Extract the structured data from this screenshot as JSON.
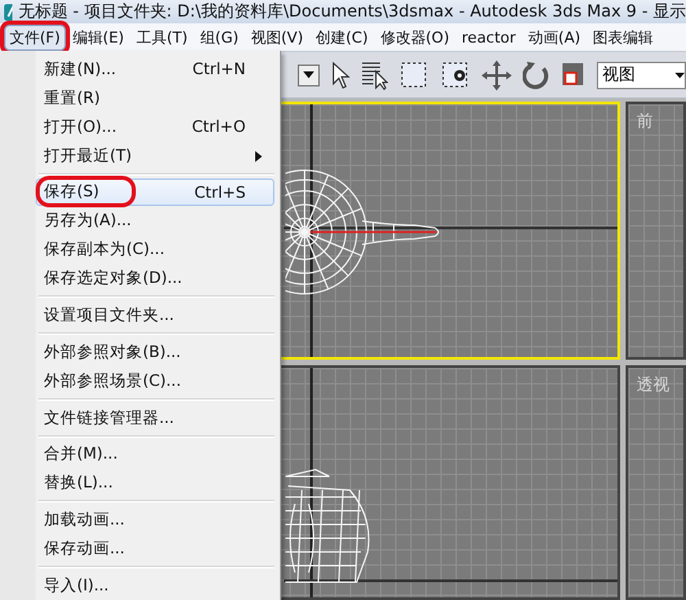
{
  "window": {
    "title": "无标题    - 项目文件夹: D:\\我的资料库\\Documents\\3dsmax    - Autodesk 3ds Max 9    - 显示"
  },
  "menubar": [
    {
      "label": "文件(F)",
      "selected": true,
      "circled": true
    },
    {
      "label": "编辑(E)",
      "selected": false,
      "circled": false
    },
    {
      "label": "工具(T)",
      "selected": false,
      "circled": false
    },
    {
      "label": "组(G)",
      "selected": false,
      "circled": false
    },
    {
      "label": "视图(V)",
      "selected": false,
      "circled": false
    },
    {
      "label": "创建(C)",
      "selected": false,
      "circled": false
    },
    {
      "label": "修改器(O)",
      "selected": false,
      "circled": false
    },
    {
      "label": "reactor",
      "selected": false,
      "circled": false
    },
    {
      "label": "动画(A)",
      "selected": false,
      "circled": false
    },
    {
      "label": "图表编辑",
      "selected": false,
      "circled": false
    }
  ],
  "file_menu": [
    {
      "kind": "item",
      "label": "新建(N)...",
      "shortcut": "Ctrl+N",
      "highlighted": false,
      "circled": false,
      "submenu": false
    },
    {
      "kind": "item",
      "label": "重置(R)",
      "highlighted": false,
      "circled": false,
      "submenu": false
    },
    {
      "kind": "item",
      "label": "打开(O)...",
      "shortcut": "Ctrl+O",
      "highlighted": false,
      "circled": false,
      "submenu": false
    },
    {
      "kind": "item",
      "label": "打开最近(T)",
      "highlighted": false,
      "circled": false,
      "submenu": true
    },
    {
      "kind": "separator"
    },
    {
      "kind": "item",
      "label": "保存(S)",
      "shortcut": "Ctrl+S",
      "highlighted": true,
      "circled": true,
      "submenu": false
    },
    {
      "kind": "item",
      "label": "另存为(A)...",
      "highlighted": false,
      "circled": false,
      "submenu": false
    },
    {
      "kind": "item",
      "label": "保存副本为(C)...",
      "highlighted": false,
      "circled": false,
      "submenu": false
    },
    {
      "kind": "item",
      "label": "保存选定对象(D)...",
      "highlighted": false,
      "circled": false,
      "submenu": false
    },
    {
      "kind": "separator"
    },
    {
      "kind": "item",
      "label": "设置项目文件夹...",
      "highlighted": false,
      "circled": false,
      "submenu": false
    },
    {
      "kind": "separator"
    },
    {
      "kind": "item",
      "label": "外部参照对象(B)...",
      "highlighted": false,
      "circled": false,
      "submenu": false
    },
    {
      "kind": "item",
      "label": "外部参照场景(C)...",
      "highlighted": false,
      "circled": false,
      "submenu": false
    },
    {
      "kind": "separator"
    },
    {
      "kind": "item",
      "label": "文件链接管理器...",
      "highlighted": false,
      "circled": false,
      "submenu": false
    },
    {
      "kind": "separator"
    },
    {
      "kind": "item",
      "label": "合并(M)...",
      "highlighted": false,
      "circled": false,
      "submenu": false
    },
    {
      "kind": "item",
      "label": "替换(L)...",
      "highlighted": false,
      "circled": false,
      "submenu": false
    },
    {
      "kind": "separator"
    },
    {
      "kind": "item",
      "label": "加载动画...",
      "highlighted": false,
      "circled": false,
      "submenu": false
    },
    {
      "kind": "item",
      "label": "保存动画...",
      "highlighted": false,
      "circled": false,
      "submenu": false
    },
    {
      "kind": "separator"
    },
    {
      "kind": "item",
      "label": "导入(I)...",
      "highlighted": false,
      "circled": false,
      "submenu": false
    }
  ],
  "toolbar": {
    "view_dropdown": {
      "value": "视图"
    }
  },
  "viewports": [
    {
      "kind": "teapot-top",
      "active": true
    },
    {
      "kind": "empty",
      "label": "前",
      "active": false
    },
    {
      "kind": "teapot-front",
      "active": false
    },
    {
      "kind": "empty",
      "label": "透视",
      "active": false
    }
  ]
}
